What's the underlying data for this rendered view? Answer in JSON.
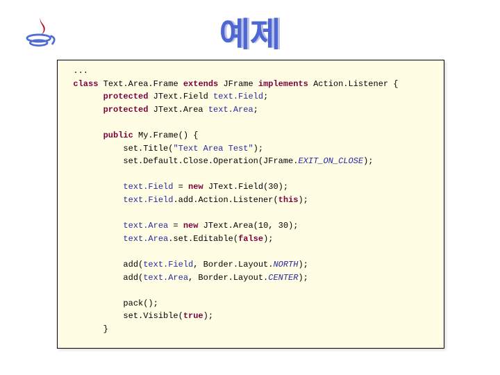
{
  "title": "예제",
  "logo_alt": "Java cup logo",
  "code": {
    "l01": "  ...",
    "kw_class": "class",
    "l02a": " Text.Area.Frame ",
    "kw_extends": "extends",
    "l02b": " JFrame ",
    "kw_implements": "implements",
    "l02c": " Action.Listener {",
    "kw_protected": "protected",
    "l03": " JText.Field ",
    "fld_textField": "text.Field",
    "semi": ";",
    "l04": " JText.Area ",
    "fld_textArea": "text.Area",
    "kw_public": "public",
    "l05": " My.Frame() {",
    "l06a": "            set.Title(",
    "str_title": "\"Text Area Test\"",
    "l06b": ");",
    "l07a": "            set.Default.Close.Operation(JFrame.",
    "cnst_exit": "EXIT_ON_CLOSE",
    "l07b": ");",
    "l08a": " = ",
    "kw_new": "new",
    "l08b": " JText.Field(30);",
    "l09a": ".add.Action.Listener(",
    "kw_this": "this",
    "l09b": ");",
    "l10b": " JText.Area(10, 30);",
    "l11a": ".set.Editable(",
    "kw_false": "false",
    "l11b": ");",
    "l12a": "            add(",
    "l12b": ", Border.Layout.",
    "cnst_north": "NORTH",
    "l12c": ");",
    "l13b": ", Border.Layout.",
    "cnst_center": "CENTER",
    "l13c": ");",
    "l14": "            pack();",
    "l15a": "            set.Visible(",
    "kw_true": "true",
    "l15b": ");",
    "l16": "        }"
  }
}
